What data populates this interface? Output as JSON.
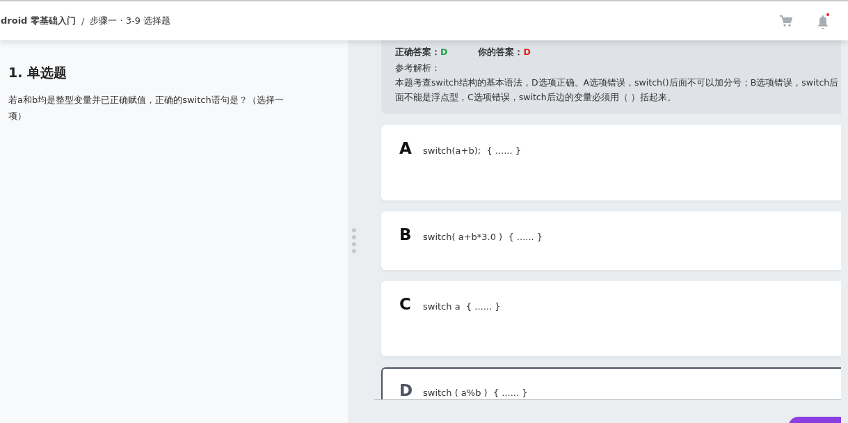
{
  "header": {
    "breadcrumb": [
      {
        "label": "droid 零基础入门",
        "kind": "course"
      },
      {
        "label": "/",
        "kind": "separator"
      },
      {
        "label": "步骤一 · 3-9 选择题",
        "kind": "step"
      }
    ]
  },
  "question": {
    "title": "1. 单选题",
    "text": "若a和b均是整型变量并已正确赋值，正确的switch语句是？（选择一项）"
  },
  "answers": [
    {
      "label": "正确答案：",
      "value": "D",
      "color": "#1aa34a"
    },
    {
      "label": "你的答案：",
      "value": "D",
      "color": "#e0201b"
    }
  ],
  "explanation": {
    "label": "参考解析：",
    "text": "本题考查switch结构的基本语法，D选项正确。A选项错误，switch()后面不可以加分号；B选项错误，switch后面不能是浮点型，C选项错误，switch后边的变量必须用（ ）括起来。"
  },
  "options": [
    {
      "letter": "A",
      "text": "switch(a+b);  { ...... }",
      "selected": false
    },
    {
      "letter": "B",
      "text": "switch( a+b*3.0 )  { ...... }",
      "selected": false
    },
    {
      "letter": "C",
      "text": "switch a  { ...... }",
      "selected": false
    },
    {
      "letter": "D",
      "text": "switch ( a%b )  { ...... }",
      "selected": true
    }
  ]
}
